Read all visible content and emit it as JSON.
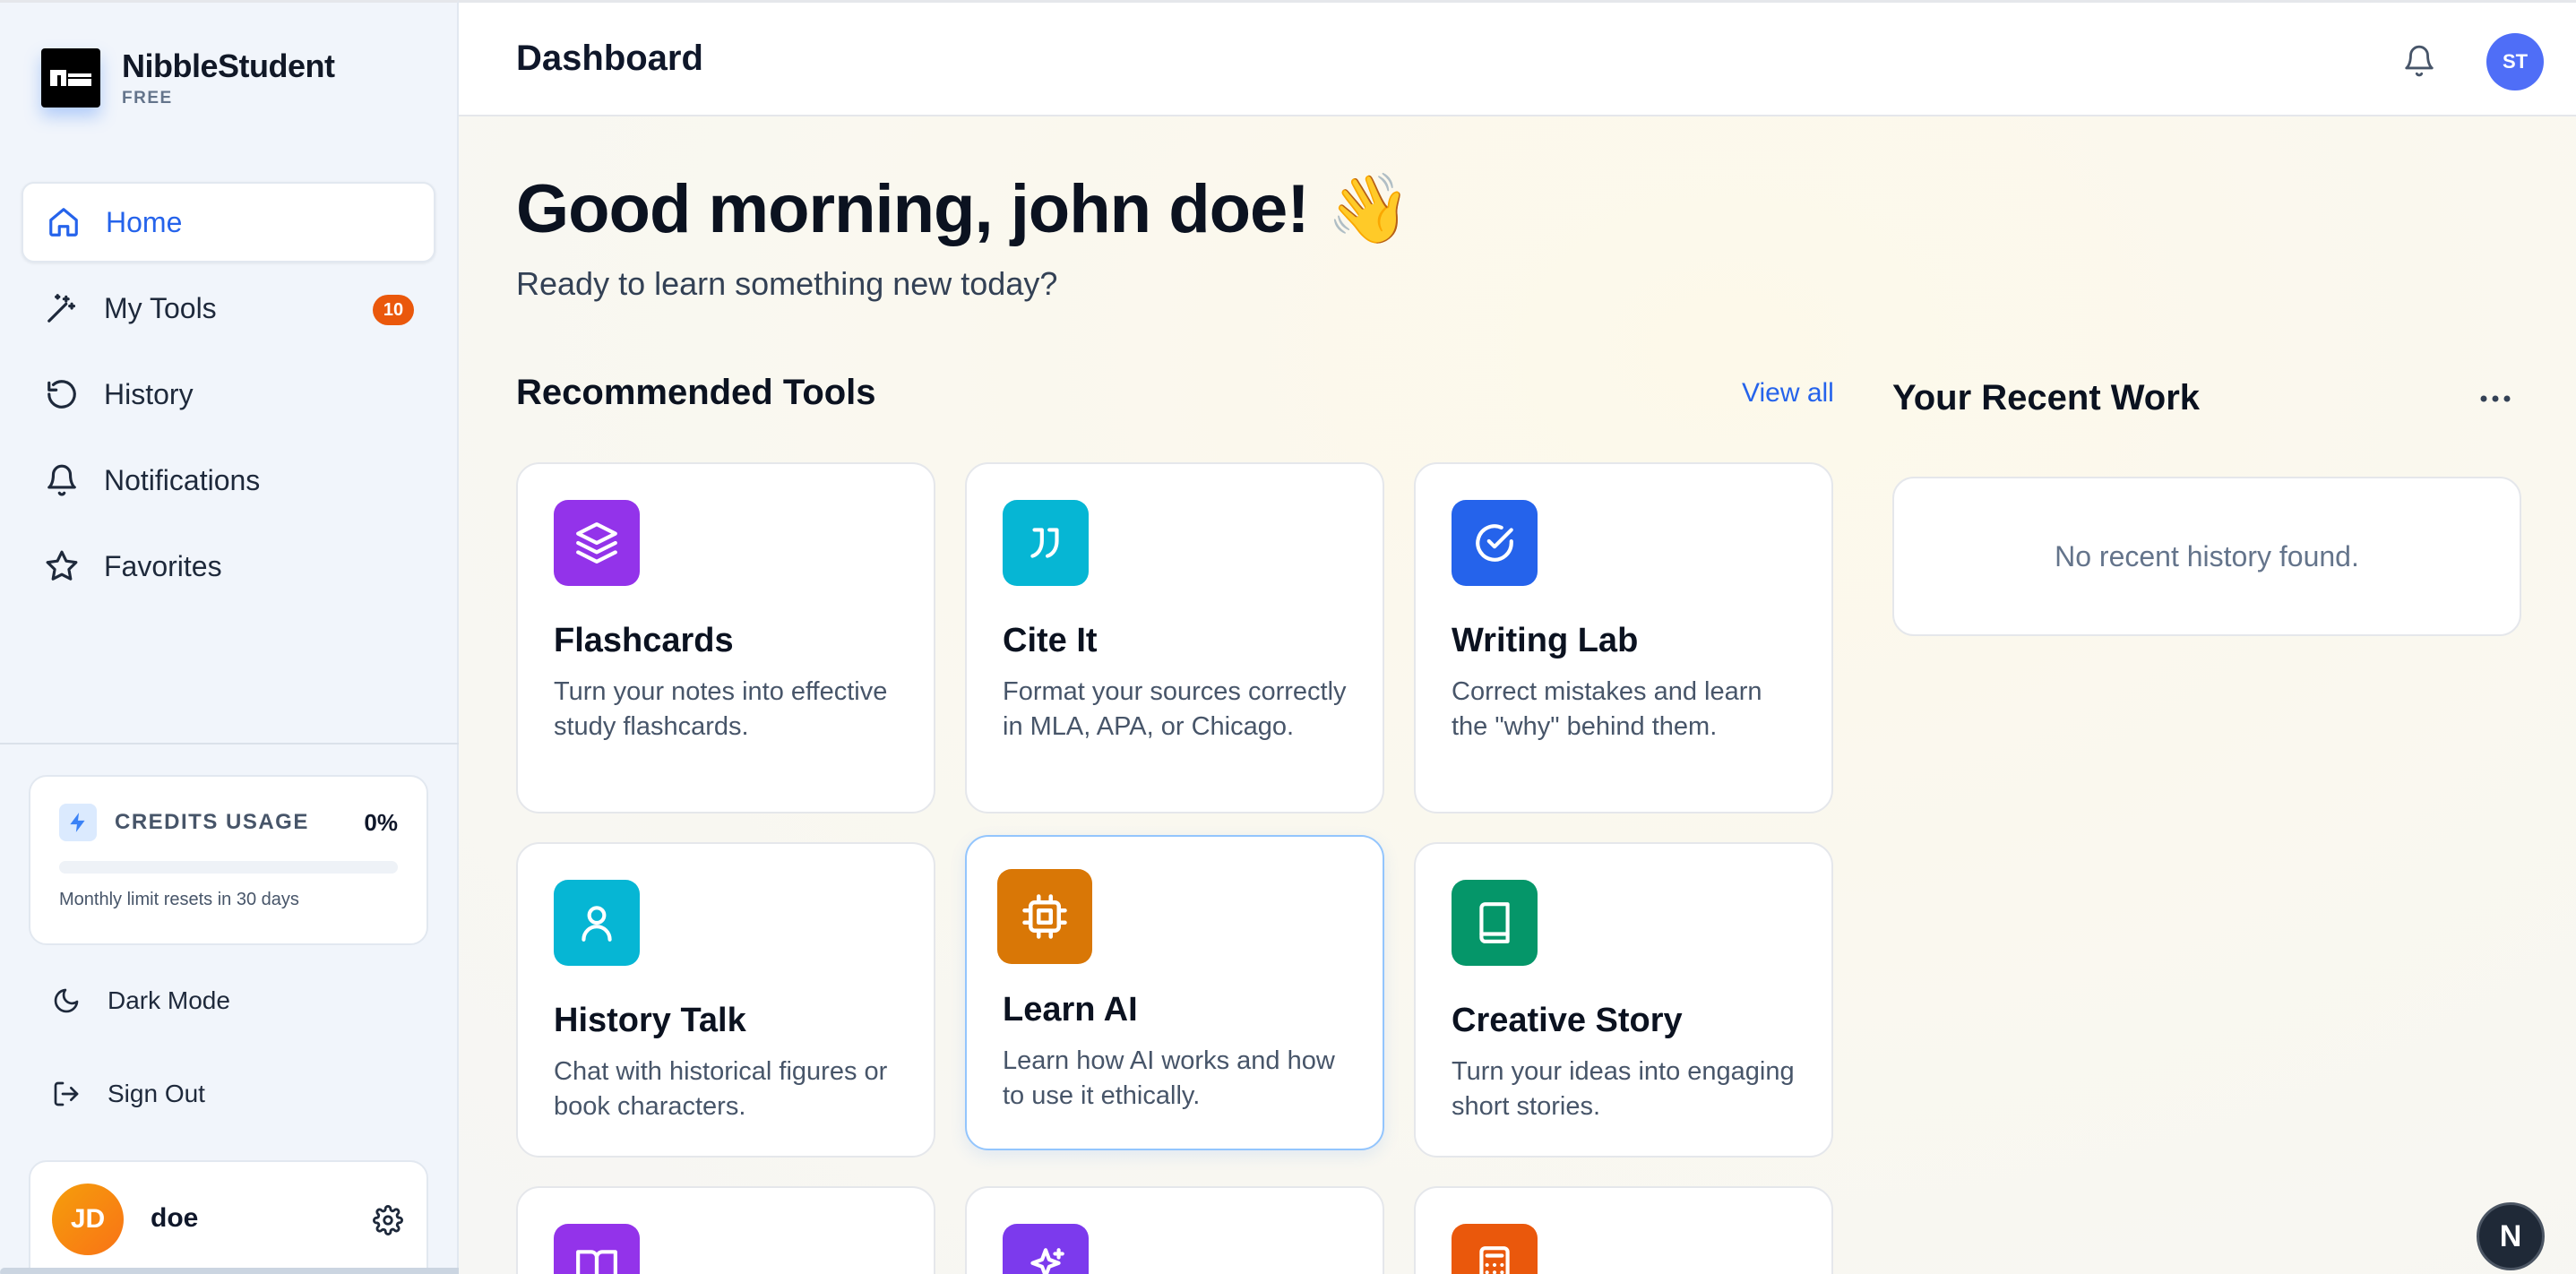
{
  "brand": {
    "name": "NibbleStudent",
    "plan": "FREE"
  },
  "sidebar": {
    "items": [
      {
        "label": "Home",
        "icon": "home-icon",
        "active": true
      },
      {
        "label": "My Tools",
        "icon": "magic-wand-icon",
        "badge": "10"
      },
      {
        "label": "History",
        "icon": "history-icon"
      },
      {
        "label": "Notifications",
        "icon": "bell-icon"
      },
      {
        "label": "Favorites",
        "icon": "star-icon"
      }
    ],
    "credits": {
      "title": "CREDITS USAGE",
      "percent": "0%",
      "value": 0,
      "note": "Monthly limit resets in 30 days"
    },
    "dark_mode": "Dark Mode",
    "sign_out": "Sign Out",
    "user": {
      "initials": "JD",
      "name": "doe"
    }
  },
  "header": {
    "title": "Dashboard",
    "avatar_initials": "ST"
  },
  "main": {
    "greeting": "Good morning, john doe! 👋",
    "subtitle": "Ready to learn something new today?",
    "recommended_title": "Recommended Tools",
    "view_all": "View all",
    "tools": [
      {
        "name": "Flashcards",
        "desc": "Turn your notes into effective study flashcards.",
        "color": "#9333ea",
        "icon": "layers-icon"
      },
      {
        "name": "Cite It",
        "desc": "Format your sources correctly in MLA, APA, or Chicago.",
        "color": "#06b6d4",
        "icon": "quote-icon"
      },
      {
        "name": "Writing Lab",
        "desc": "Correct mistakes and learn the \"why\" behind them.",
        "color": "#2563eb",
        "icon": "check-circle-icon"
      },
      {
        "name": "History Talk",
        "desc": "Chat with historical figures or book characters.",
        "color": "#06b6d4",
        "icon": "user-icon"
      },
      {
        "name": "Learn AI",
        "desc": "Learn how AI works and how to use it ethically.",
        "color": "#d97706",
        "icon": "chip-icon"
      },
      {
        "name": "Creative Story",
        "desc": "Turn your ideas into engaging short stories.",
        "color": "#059669",
        "icon": "book-icon"
      }
    ],
    "more_tools": [
      {
        "color": "#9333ea",
        "icon": "open-book-icon"
      },
      {
        "color": "#7c3aed",
        "icon": "sparkles-icon"
      },
      {
        "color": "#ea580c",
        "icon": "calculator-icon"
      }
    ],
    "recent_title": "Your Recent Work",
    "recent_empty": "No recent history found."
  },
  "next_badge": "N"
}
